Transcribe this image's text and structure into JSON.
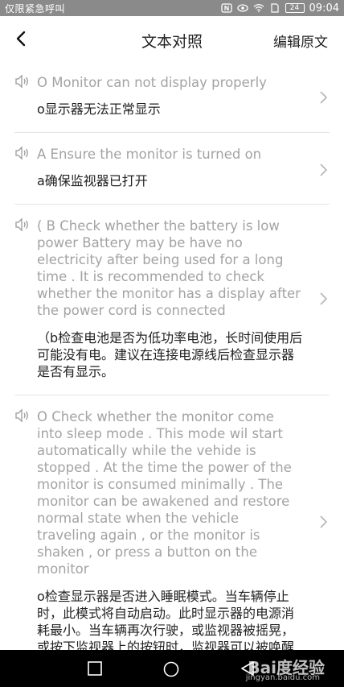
{
  "status_bar": {
    "carrier": "仅限紧急呼叫",
    "battery": "24",
    "time": "09:04",
    "icons": [
      "nfc-icon",
      "eye-icon",
      "wifi-icon",
      "sim-icon",
      "battery-icon"
    ]
  },
  "header": {
    "title": "文本对照",
    "edit_label": "编辑原文",
    "back_icon": "chevron-left-icon"
  },
  "items": [
    {
      "en": "O Monitor can not display properly",
      "zh": "o显示器无法正常显示"
    },
    {
      "en": "A Ensure the monitor is turned on",
      "zh": "a确保监视器已打开"
    },
    {
      "en": "( B Check whether the battery is low power Battery may be have no electricity after being used for a long time . It is recommended to check whether the monitor has a display after the power cord is connected",
      "zh": "（b检查电池是否为低功率电池，长时间使用后可能没有电。建议在连接电源线后检查显示器是否有显示。"
    },
    {
      "en": "O Check whether the monitor come into sleep mode . This mode wil start automatically while the vehide is stopped . At the time the power of the monitor is consumed minimally . The monitor can be awakened and restore normal state when the vehicle traveling again , or the monitor is shaken , or press a button on the monitor",
      "zh": "o检查显示器是否进入睡眠模式。当车辆停止时，此模式将自动启动。此时显示器的电源消耗最小。当车辆再次行驶，或监视器被摇晃，或按下监视器上的按钮时，监视器可以被唤醒并恢复正常状态。"
    }
  ],
  "nav_bar": {
    "icons": [
      "square-icon",
      "circle-icon",
      "triangle-back-icon"
    ]
  },
  "watermark": {
    "brand": "Bai度经验",
    "url": "jingyan.baidu.com"
  }
}
